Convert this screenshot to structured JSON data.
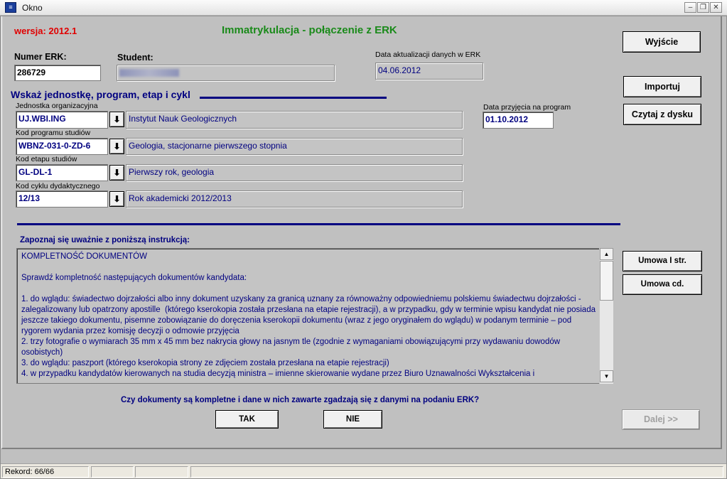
{
  "window": {
    "title": "Okno",
    "icon": "app-icon",
    "minimize": "–",
    "restore": "❐",
    "close": "✕"
  },
  "header": {
    "version": "wersja: 2012.1",
    "title": "Immatrykulacja - połączenie z ERK",
    "version_color": "#e00000",
    "title_color": "#1a8a1a"
  },
  "student": {
    "erk_label": "Numer ERK:",
    "erk_value": "286729",
    "student_label": "Student:",
    "student_value": "",
    "update_label": "Data aktualizacji danych w ERK",
    "update_value": "04.06.2012"
  },
  "section": {
    "heading": "Wskaż jednostkę, program, etap i cykl",
    "admission_label": "Data przyjęcia na program",
    "admission_value": "01.10.2012",
    "rows": [
      {
        "label": "Jednostka organizacyjna",
        "code": "UJ.WBI.ING",
        "desc": "Instytut Nauk Geologicznych"
      },
      {
        "label": "Kod programu studiów",
        "code": "WBNZ-031-0-ZD-6",
        "desc": "Geologia, stacjonarne pierwszego stopnia"
      },
      {
        "label": "Kod etapu studiów",
        "code": "GL-DL-1",
        "desc": "Pierwszy rok, geologia"
      },
      {
        "label": "Kod cyklu dydaktycznego",
        "code": "12/13",
        "desc": "Rok akademicki 2012/2013"
      }
    ]
  },
  "buttons": {
    "exit": "Wyjście",
    "import": "Importuj",
    "read_disk": "Czytaj z dysku",
    "contract1": "Umowa I str.",
    "contract2": "Umowa cd.",
    "yes": "TAK",
    "no": "NIE",
    "next": "Dalej >>"
  },
  "instructions": {
    "label": "Zapoznaj się uważnie z poniższą instrukcją:",
    "text": "KOMPLETNOŚĆ DOKUMENTÓW\n\nSprawdź kompletność następujących dokumentów kandydata:\n\n1. do wglądu: świadectwo dojrzałości albo inny dokument uzyskany za granicą uznany za równoważny odpowiedniemu polskiemu świadectwu dojrzałości - zalegalizowany lub opatrzony apostille  (którego kserokopia została przesłana na etapie rejestracji), a w przypadku, gdy w terminie wpisu kandydat nie posiada jeszcze takiego dokumentu, pisemne zobowiązanie do doręczenia kserokopii dokumentu (wraz z jego oryginałem do wglądu) w podanym terminie – pod rygorem wydania przez komisję decyzji o odmowie przyjęcia\n2. trzy fotografie o wymiarach 35 mm x 45 mm bez nakrycia głowy na jasnym tle (zgodnie z wymaganiami obowiązującymi przy wydawaniu dowodów osobistych)\n3. do wglądu: paszport (którego kserokopia strony ze zdjęciem została przesłana na etapie rejestracji)\n4. w przypadku kandydatów kierowanych na studia decyzją ministra – imienne skierowanie wydane przez Biuro Uznawalności Wykształcenia i"
  },
  "question": "Czy dokumenty są kompletne i dane w nich zawarte zgadzają się z danymi na podaniu ERK?",
  "status": {
    "record": "Rekord: 66/66"
  },
  "icons": {
    "download": "download-arrow-icon",
    "scroll_up": "scroll-up-icon",
    "scroll_down": "scroll-down-icon"
  }
}
